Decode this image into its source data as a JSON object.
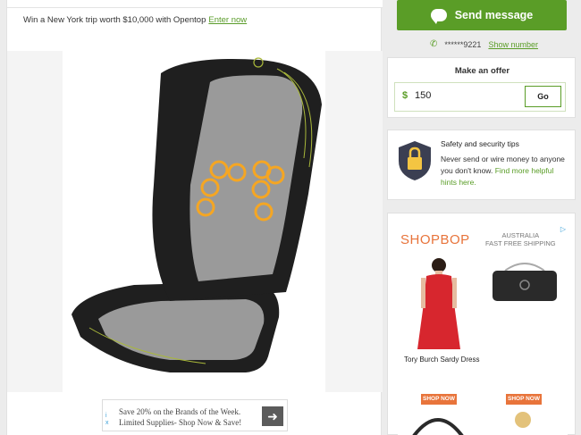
{
  "promo": {
    "text": "Win a New York trip worth $10,000 with Opentop",
    "link": "Enter now"
  },
  "product_photo": {
    "alt": "massage seat cushion"
  },
  "ad_banner": {
    "text": "Save 20% on the Brands of the Week. Limited Supplies- Shop Now & Save!"
  },
  "contact": {
    "send_label": "Send message",
    "phone_masked": "******9221",
    "show_number": "Show number"
  },
  "offer": {
    "title": "Make an offer",
    "currency": "$",
    "value": "150",
    "go_label": "Go"
  },
  "safety": {
    "title": "Safety and security tips",
    "body": "Never send or wire money to anyone you don't know.",
    "link": "Find more helpful hints here."
  },
  "side_ad": {
    "brand": "SHOPBOP",
    "tag_line1": "AUSTRALIA",
    "tag_line2": "FAST FREE SHIPPING",
    "caption": "Tory Burch Sardy Dress",
    "shop_now_1": "SHOP NOW",
    "shop_now_2": "SHOP NOW"
  },
  "colors": {
    "brand_green": "#5a9d27",
    "shopbop_orange": "#e8743b"
  }
}
